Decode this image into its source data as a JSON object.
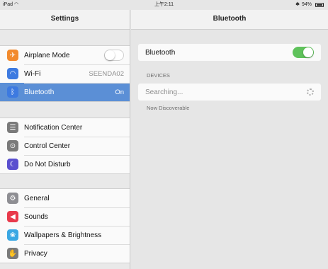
{
  "status_bar": {
    "device": "iPad",
    "time": "上午2:11",
    "battery": "94%"
  },
  "sidebar": {
    "title": "Settings",
    "groups": [
      {
        "items": [
          {
            "label": "Airplane Mode",
            "icon": "airplane-icon",
            "color": "#f28a2d",
            "toggle": "off"
          },
          {
            "label": "Wi-Fi",
            "icon": "wifi-icon",
            "color": "#3d7ae0",
            "value": "SEENDA02"
          },
          {
            "label": "Bluetooth",
            "icon": "bluetooth-icon",
            "color": "#3d7ae0",
            "value": "On",
            "selected": true
          }
        ]
      },
      {
        "items": [
          {
            "label": "Notification Center",
            "icon": "notification-center-icon",
            "color": "#7a7a7a"
          },
          {
            "label": "Control Center",
            "icon": "control-center-icon",
            "color": "#7a7a7a"
          },
          {
            "label": "Do Not Disturb",
            "icon": "moon-icon",
            "color": "#5a4fcf"
          }
        ]
      },
      {
        "items": [
          {
            "label": "General",
            "icon": "gear-icon",
            "color": "#8e8e93"
          },
          {
            "label": "Sounds",
            "icon": "speaker-icon",
            "color": "#e83a4b"
          },
          {
            "label": "Wallpapers & Brightness",
            "icon": "flower-icon",
            "color": "#3aa7e3"
          },
          {
            "label": "Privacy",
            "icon": "hand-icon",
            "color": "#7a7a7a"
          }
        ]
      }
    ]
  },
  "detail": {
    "title": "Bluetooth",
    "bluetooth_label": "Bluetooth",
    "bluetooth_toggle": "on",
    "devices_header": "DEVICES",
    "searching_text": "Searching...",
    "discoverable_text": "Now Discoverable"
  }
}
